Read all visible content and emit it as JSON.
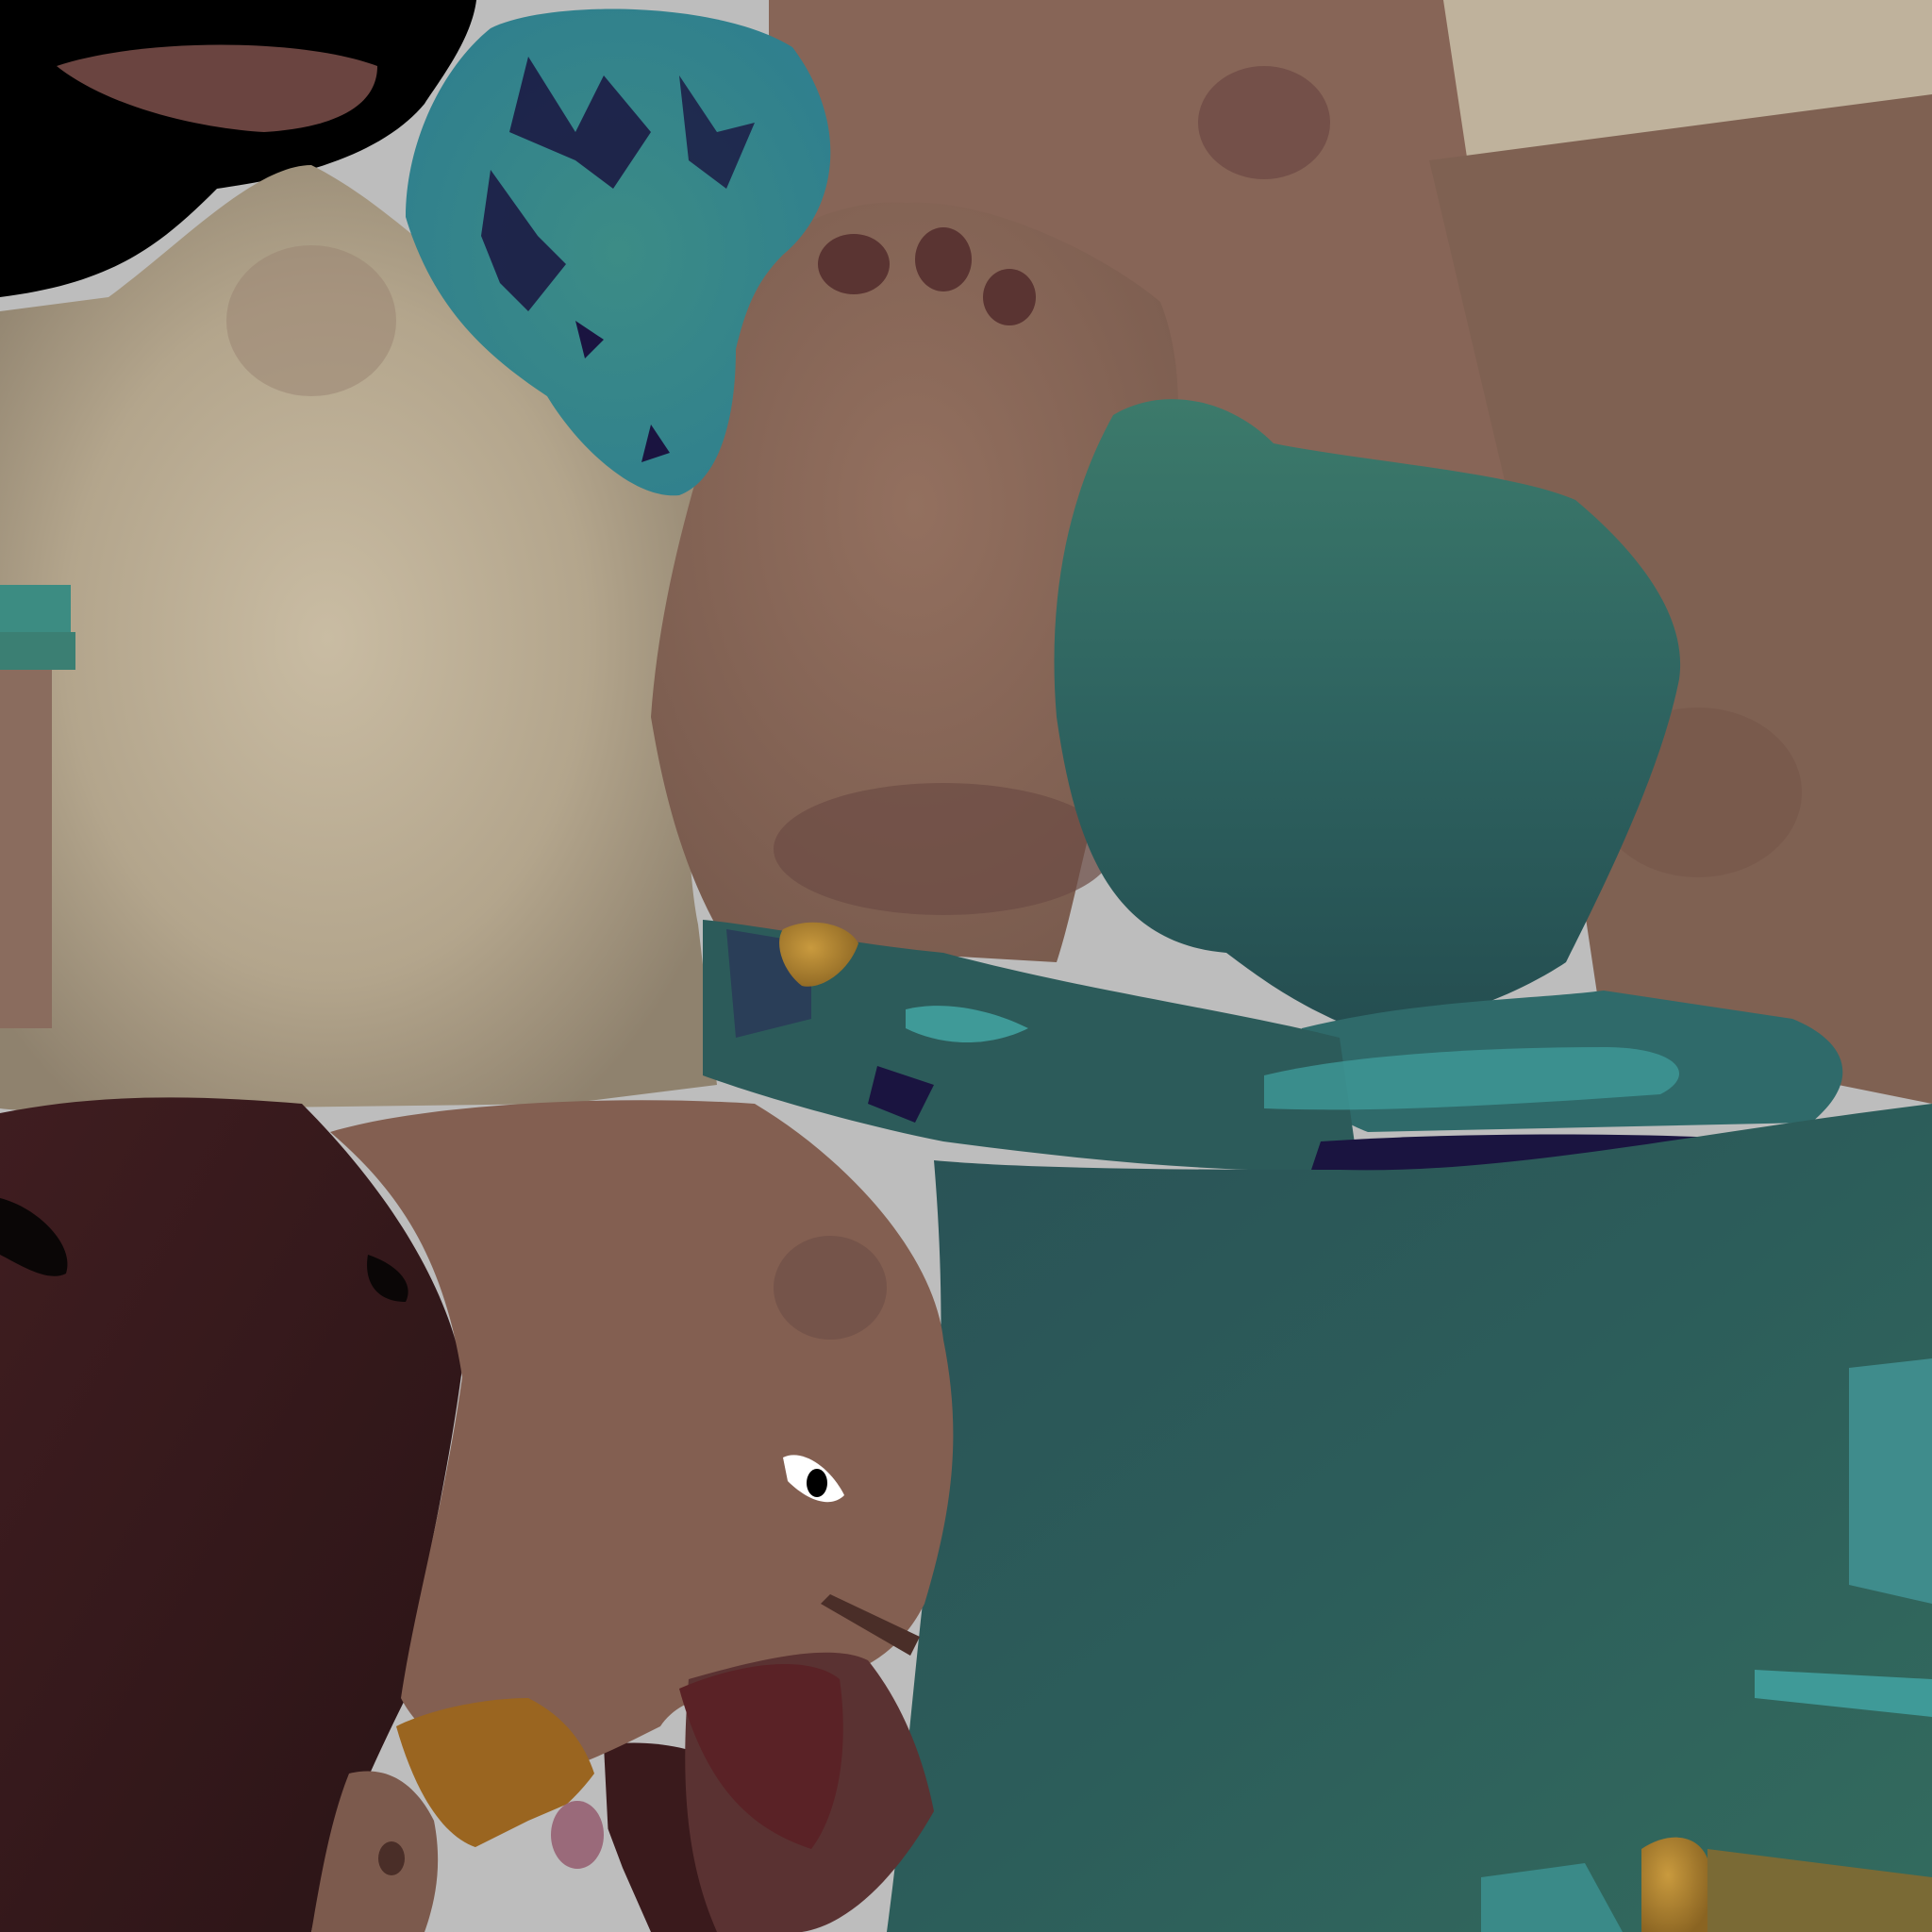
{
  "image": {
    "kind": "uv-texture-atlas",
    "visible_text": []
  },
  "palette": {
    "background": "#bdbdbd",
    "cream": "#b8ab92",
    "skin_light": "#8e6c5c",
    "skin_mid": "#7e6052",
    "skin_dark": "#6c4e45",
    "teal_light": "#3b7a6c",
    "teal_mid": "#2f6660",
    "teal_dark": "#214a4d",
    "teal_bright": "#3f9a98",
    "navy": "#1a1440",
    "maroon": "#3e1c1e",
    "maroon_dark": "#2a1416",
    "gold": "#a77a2a",
    "orange": "#9a6520",
    "red": "#5a2226",
    "pink": "#9a6a7a",
    "black": "#000000"
  },
  "regions": [
    "black-patch-region",
    "teal-flower-region",
    "skin-hand-region",
    "cream-region",
    "teal-cloth-region",
    "maroon-region",
    "face-region",
    "gold-trim-region"
  ]
}
